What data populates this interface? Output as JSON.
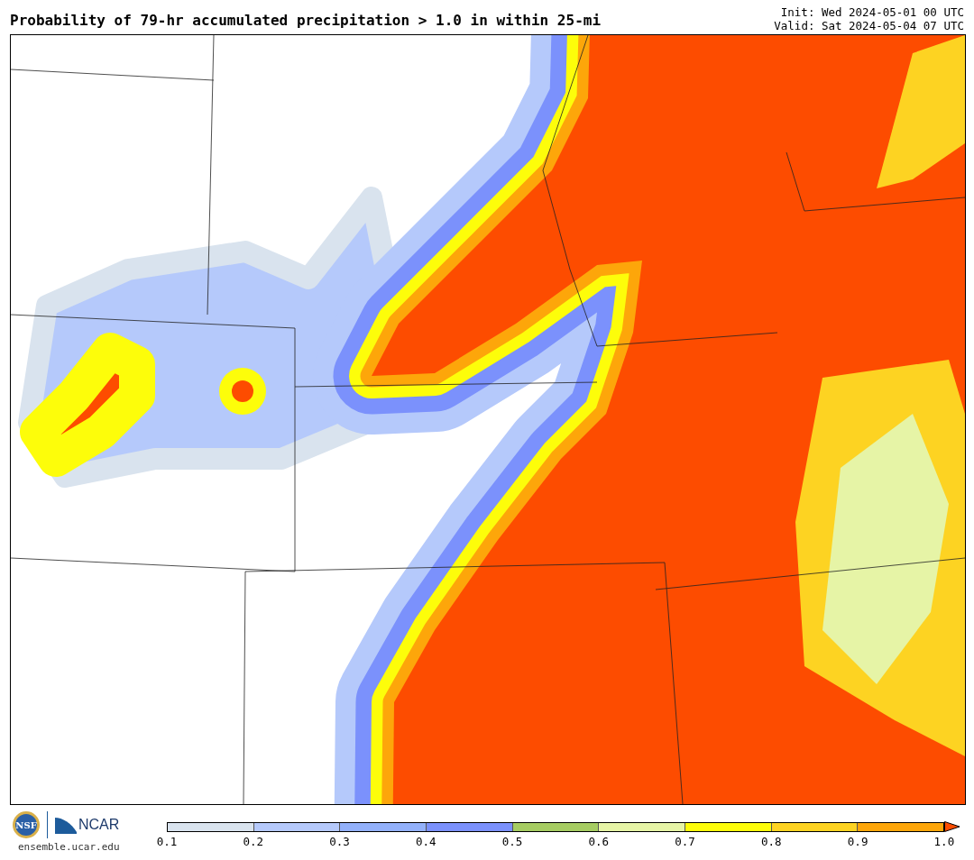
{
  "title": "Probability of 79-hr accumulated precipitation > 1.0 in within 25-mi",
  "init": "Init: Wed 2024-05-01 00 UTC",
  "valid": "Valid: Sat 2024-05-04 07 UTC",
  "logos": {
    "nsf": "NSF",
    "ncar": "NCAR"
  },
  "site": "ensemble.ucar.edu",
  "colorbar": {
    "bins": [
      {
        "color": "#d9e3ee"
      },
      {
        "color": "#b5c9fb"
      },
      {
        "color": "#93b1fb"
      },
      {
        "color": "#7b91fc"
      },
      {
        "color": "#a6cc62"
      },
      {
        "color": "#e6f4a6"
      },
      {
        "color": "#fdfd0a"
      },
      {
        "color": "#fdd322"
      },
      {
        "color": "#fda60a"
      },
      {
        "kind": "arrow",
        "color": "#fd4c00"
      }
    ],
    "ticks": [
      "0.1",
      "0.2",
      "0.3",
      "0.4",
      "0.5",
      "0.6",
      "0.7",
      "0.8",
      "0.9",
      "1.0"
    ]
  }
}
